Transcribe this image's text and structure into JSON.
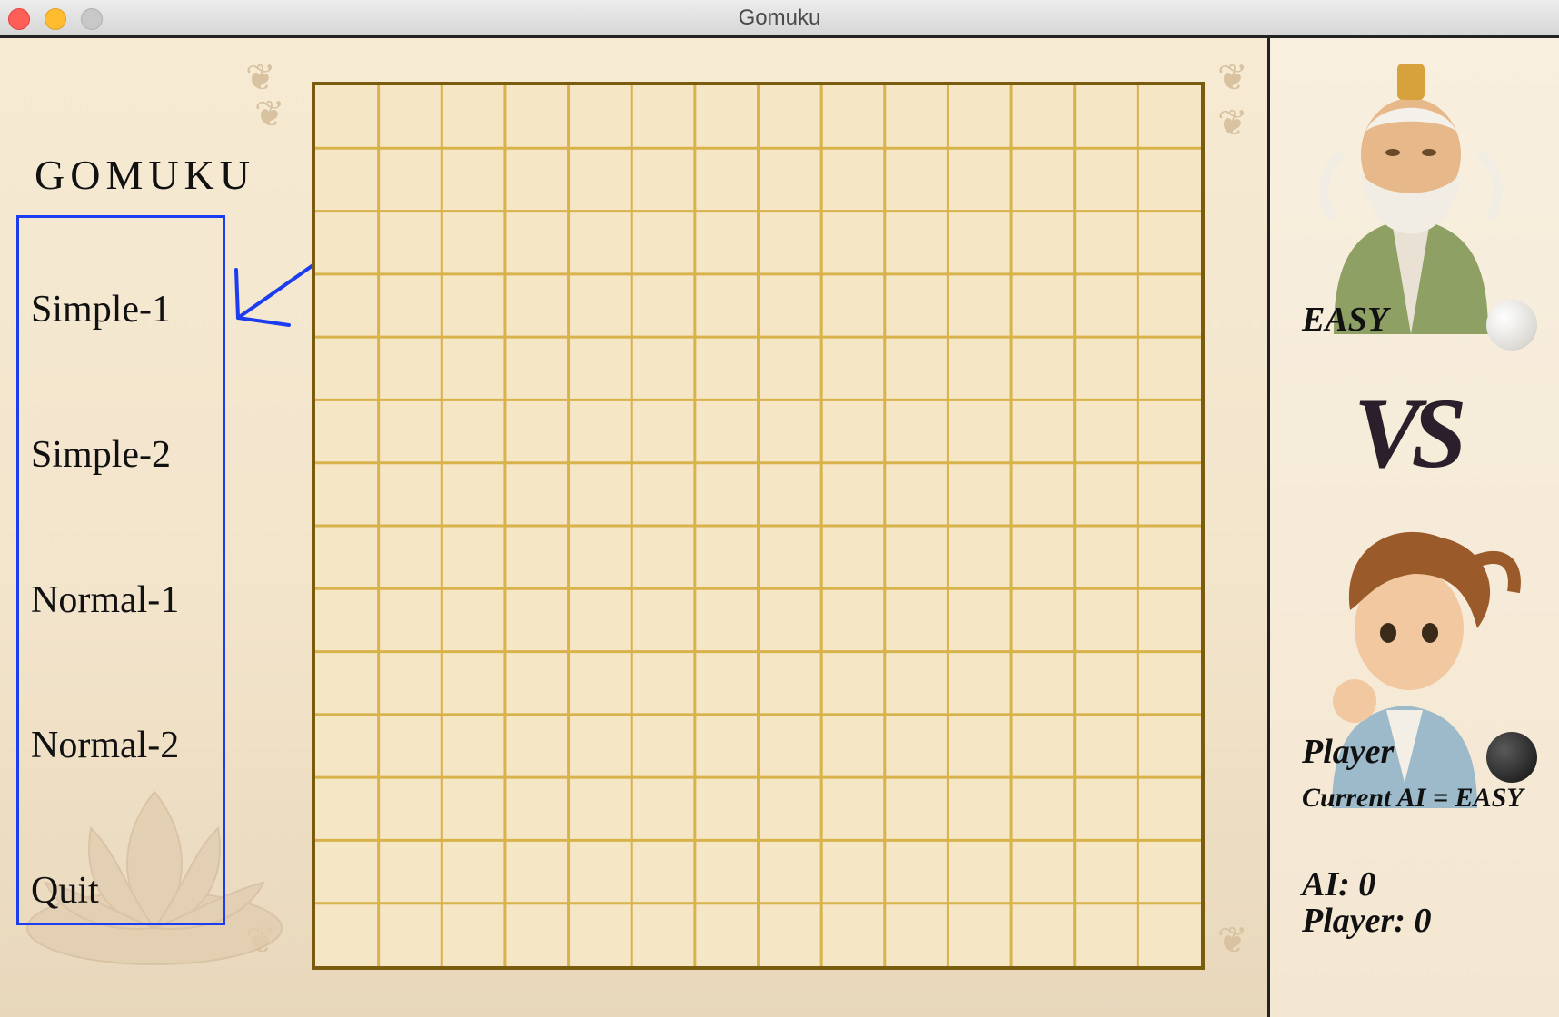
{
  "window": {
    "title": "Gomuku"
  },
  "sidebar": {
    "title": "GOMUKU",
    "menu": [
      {
        "label": "Simple-1"
      },
      {
        "label": "Simple-2"
      },
      {
        "label": "Normal-1"
      },
      {
        "label": "Normal-2"
      },
      {
        "label": "Quit"
      }
    ]
  },
  "board": {
    "columns": 14,
    "rows": 14,
    "line_color": "#d8b24a",
    "border_color": "#7a5c0f"
  },
  "right_panel": {
    "ai_label": "EASY",
    "vs_label": "VS",
    "player_label": "Player",
    "current_ai": "Current AI = EASY",
    "score_ai": "AI: 0",
    "score_player": "Player: 0"
  },
  "colors": {
    "accent_box": "#1c3cf0",
    "stone_white": "#f4f2ee",
    "stone_black": "#2a2a2a"
  }
}
